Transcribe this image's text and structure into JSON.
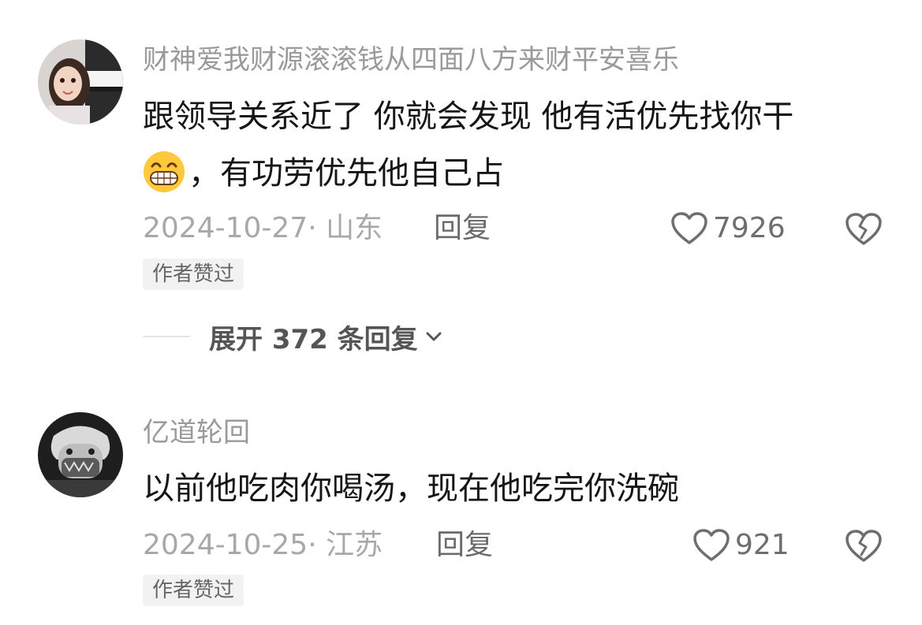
{
  "comments": [
    {
      "username": "财神爱我财源滚滚钱从四面八方来财平安喜乐",
      "text_line1": "跟领导关系近了 你就会发现 他有活优先找你干",
      "text_line2": "，有功劳优先他自己占",
      "emoji": "grinning-face-emoji",
      "date_location": "2024-10-27· 山东",
      "reply_label": "回复",
      "like_count": "7926",
      "badge": "作者赞过"
    },
    {
      "username": "亿道轮回",
      "text_line1": "以前他吃肉你喝汤，现在他吃完你洗碗",
      "date_location": "2024-10-25· 江苏",
      "reply_label": "回复",
      "like_count": "921",
      "badge": "作者赞过"
    }
  ],
  "expand_replies": "展开 372 条回复",
  "icons": {
    "like": "heart-outline-icon",
    "dislike": "broken-heart-icon",
    "expand": "chevron-down-icon"
  },
  "colors": {
    "username": "#9a9a9a",
    "text": "#161616",
    "meta": "#a8a8a8",
    "badge_bg": "#f2f2f2"
  }
}
